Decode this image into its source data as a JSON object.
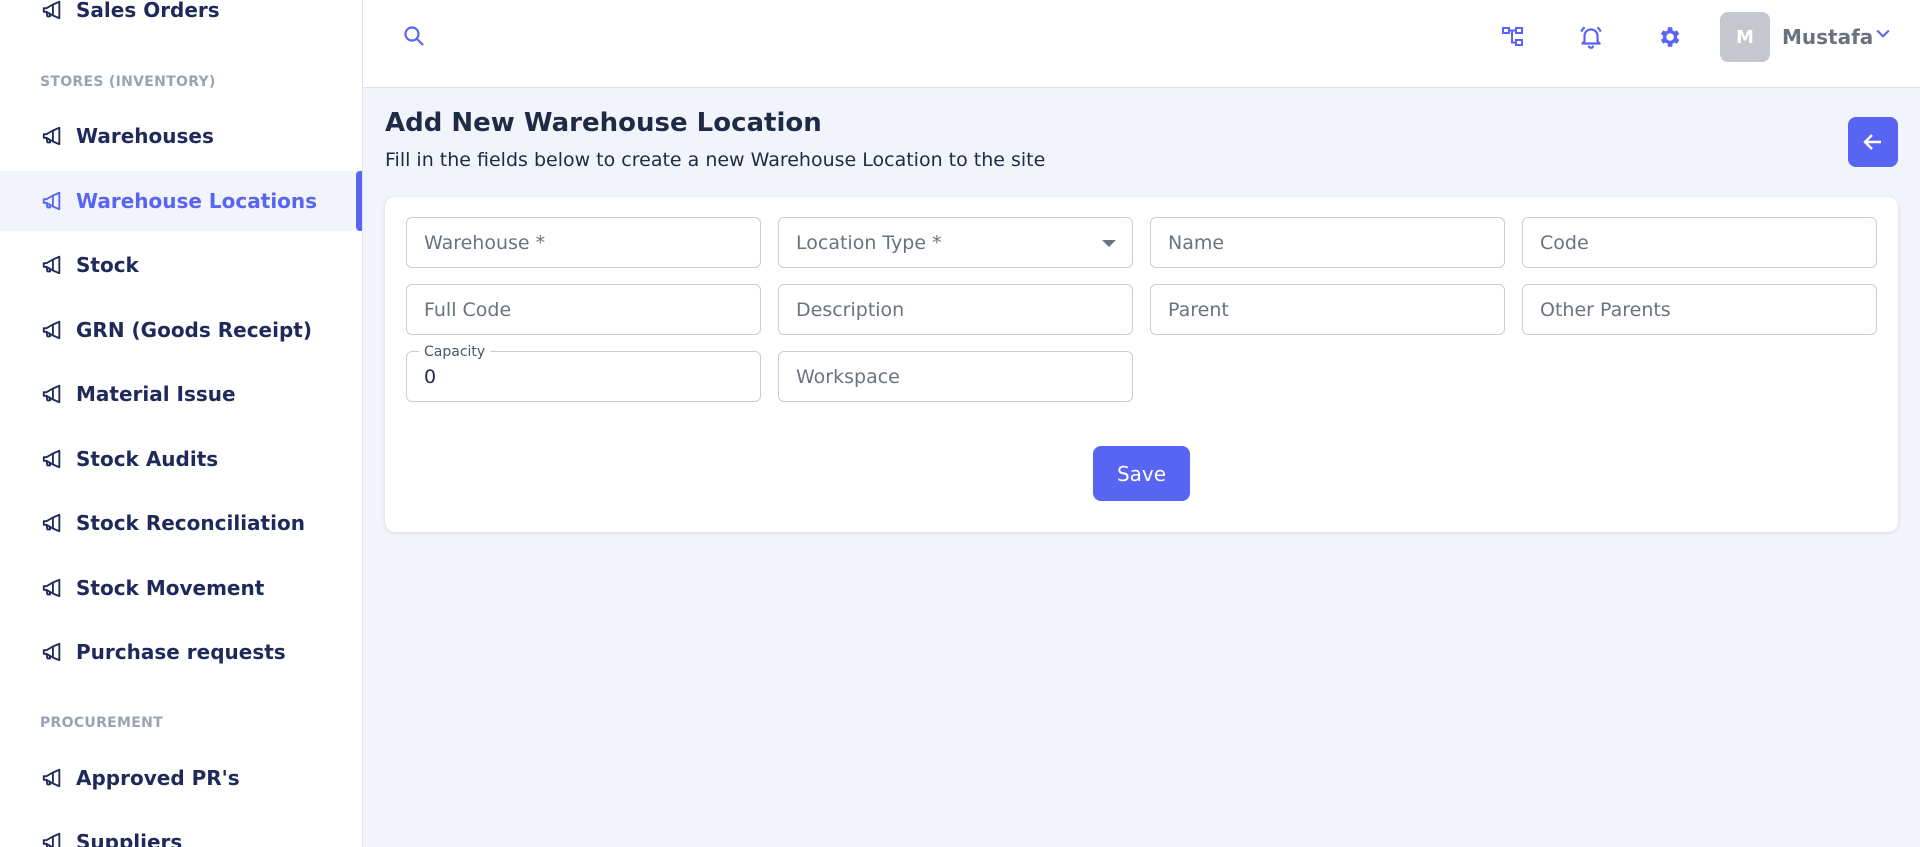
{
  "sidebar": {
    "items_top": [
      {
        "label": "Sales Orders",
        "icon": "megaphone-icon"
      }
    ],
    "sections": [
      {
        "title": "STORES (INVENTORY)"
      },
      {
        "title": "PROCUREMENT"
      }
    ],
    "stores_items": [
      {
        "label": "Warehouses"
      },
      {
        "label": "Warehouse Locations"
      },
      {
        "label": "Stock"
      },
      {
        "label": "GRN (Goods Receipt)"
      },
      {
        "label": "Material Issue"
      },
      {
        "label": "Stock Audits"
      },
      {
        "label": "Stock Reconciliation"
      },
      {
        "label": "Stock Movement"
      },
      {
        "label": "Purchase requests"
      }
    ],
    "procurement_items": [
      {
        "label": "Approved PR's"
      },
      {
        "label": "Suppliers"
      }
    ],
    "active_item": "Warehouse Locations"
  },
  "topbar": {
    "icons": [
      "search-icon",
      "org-chart-icon",
      "bell-icon",
      "gear-icon",
      "chevron-down-icon"
    ],
    "user": {
      "initial": "M",
      "name": "Mustafa"
    }
  },
  "page": {
    "title": "Add New Warehouse Location",
    "subtitle": "Fill in the fields below to create a new Warehouse Location to the site"
  },
  "form": {
    "warehouse": {
      "placeholder": "Warehouse *"
    },
    "location_type": {
      "placeholder": "Location Type *"
    },
    "name": {
      "placeholder": "Name"
    },
    "code": {
      "placeholder": "Code"
    },
    "full_code": {
      "placeholder": "Full Code"
    },
    "description": {
      "placeholder": "Description"
    },
    "parent": {
      "placeholder": "Parent"
    },
    "other_parents": {
      "placeholder": "Other Parents"
    },
    "capacity": {
      "label": "Capacity",
      "value": "0"
    },
    "workspace": {
      "placeholder": "Workspace"
    },
    "save_label": "Save"
  },
  "colors": {
    "accent": "#5865f2",
    "nav_text": "#1f2a5a",
    "section_title": "#9aa3b5"
  }
}
